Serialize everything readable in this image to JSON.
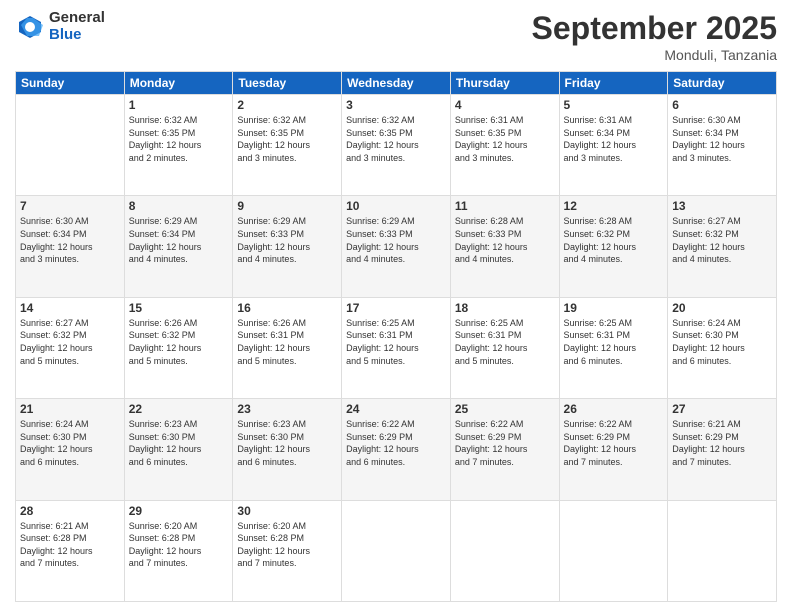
{
  "logo": {
    "general": "General",
    "blue": "Blue"
  },
  "title": "September 2025",
  "location": "Monduli, Tanzania",
  "days_header": [
    "Sunday",
    "Monday",
    "Tuesday",
    "Wednesday",
    "Thursday",
    "Friday",
    "Saturday"
  ],
  "weeks": [
    [
      {
        "day": "",
        "info": ""
      },
      {
        "day": "1",
        "info": "Sunrise: 6:32 AM\nSunset: 6:35 PM\nDaylight: 12 hours\nand 2 minutes."
      },
      {
        "day": "2",
        "info": "Sunrise: 6:32 AM\nSunset: 6:35 PM\nDaylight: 12 hours\nand 3 minutes."
      },
      {
        "day": "3",
        "info": "Sunrise: 6:32 AM\nSunset: 6:35 PM\nDaylight: 12 hours\nand 3 minutes."
      },
      {
        "day": "4",
        "info": "Sunrise: 6:31 AM\nSunset: 6:35 PM\nDaylight: 12 hours\nand 3 minutes."
      },
      {
        "day": "5",
        "info": "Sunrise: 6:31 AM\nSunset: 6:34 PM\nDaylight: 12 hours\nand 3 minutes."
      },
      {
        "day": "6",
        "info": "Sunrise: 6:30 AM\nSunset: 6:34 PM\nDaylight: 12 hours\nand 3 minutes."
      }
    ],
    [
      {
        "day": "7",
        "info": "Sunrise: 6:30 AM\nSunset: 6:34 PM\nDaylight: 12 hours\nand 3 minutes."
      },
      {
        "day": "8",
        "info": "Sunrise: 6:29 AM\nSunset: 6:34 PM\nDaylight: 12 hours\nand 4 minutes."
      },
      {
        "day": "9",
        "info": "Sunrise: 6:29 AM\nSunset: 6:33 PM\nDaylight: 12 hours\nand 4 minutes."
      },
      {
        "day": "10",
        "info": "Sunrise: 6:29 AM\nSunset: 6:33 PM\nDaylight: 12 hours\nand 4 minutes."
      },
      {
        "day": "11",
        "info": "Sunrise: 6:28 AM\nSunset: 6:33 PM\nDaylight: 12 hours\nand 4 minutes."
      },
      {
        "day": "12",
        "info": "Sunrise: 6:28 AM\nSunset: 6:32 PM\nDaylight: 12 hours\nand 4 minutes."
      },
      {
        "day": "13",
        "info": "Sunrise: 6:27 AM\nSunset: 6:32 PM\nDaylight: 12 hours\nand 4 minutes."
      }
    ],
    [
      {
        "day": "14",
        "info": "Sunrise: 6:27 AM\nSunset: 6:32 PM\nDaylight: 12 hours\nand 5 minutes."
      },
      {
        "day": "15",
        "info": "Sunrise: 6:26 AM\nSunset: 6:32 PM\nDaylight: 12 hours\nand 5 minutes."
      },
      {
        "day": "16",
        "info": "Sunrise: 6:26 AM\nSunset: 6:31 PM\nDaylight: 12 hours\nand 5 minutes."
      },
      {
        "day": "17",
        "info": "Sunrise: 6:25 AM\nSunset: 6:31 PM\nDaylight: 12 hours\nand 5 minutes."
      },
      {
        "day": "18",
        "info": "Sunrise: 6:25 AM\nSunset: 6:31 PM\nDaylight: 12 hours\nand 5 minutes."
      },
      {
        "day": "19",
        "info": "Sunrise: 6:25 AM\nSunset: 6:31 PM\nDaylight: 12 hours\nand 6 minutes."
      },
      {
        "day": "20",
        "info": "Sunrise: 6:24 AM\nSunset: 6:30 PM\nDaylight: 12 hours\nand 6 minutes."
      }
    ],
    [
      {
        "day": "21",
        "info": "Sunrise: 6:24 AM\nSunset: 6:30 PM\nDaylight: 12 hours\nand 6 minutes."
      },
      {
        "day": "22",
        "info": "Sunrise: 6:23 AM\nSunset: 6:30 PM\nDaylight: 12 hours\nand 6 minutes."
      },
      {
        "day": "23",
        "info": "Sunrise: 6:23 AM\nSunset: 6:30 PM\nDaylight: 12 hours\nand 6 minutes."
      },
      {
        "day": "24",
        "info": "Sunrise: 6:22 AM\nSunset: 6:29 PM\nDaylight: 12 hours\nand 6 minutes."
      },
      {
        "day": "25",
        "info": "Sunrise: 6:22 AM\nSunset: 6:29 PM\nDaylight: 12 hours\nand 7 minutes."
      },
      {
        "day": "26",
        "info": "Sunrise: 6:22 AM\nSunset: 6:29 PM\nDaylight: 12 hours\nand 7 minutes."
      },
      {
        "day": "27",
        "info": "Sunrise: 6:21 AM\nSunset: 6:29 PM\nDaylight: 12 hours\nand 7 minutes."
      }
    ],
    [
      {
        "day": "28",
        "info": "Sunrise: 6:21 AM\nSunset: 6:28 PM\nDaylight: 12 hours\nand 7 minutes."
      },
      {
        "day": "29",
        "info": "Sunrise: 6:20 AM\nSunset: 6:28 PM\nDaylight: 12 hours\nand 7 minutes."
      },
      {
        "day": "30",
        "info": "Sunrise: 6:20 AM\nSunset: 6:28 PM\nDaylight: 12 hours\nand 7 minutes."
      },
      {
        "day": "",
        "info": ""
      },
      {
        "day": "",
        "info": ""
      },
      {
        "day": "",
        "info": ""
      },
      {
        "day": "",
        "info": ""
      }
    ]
  ]
}
